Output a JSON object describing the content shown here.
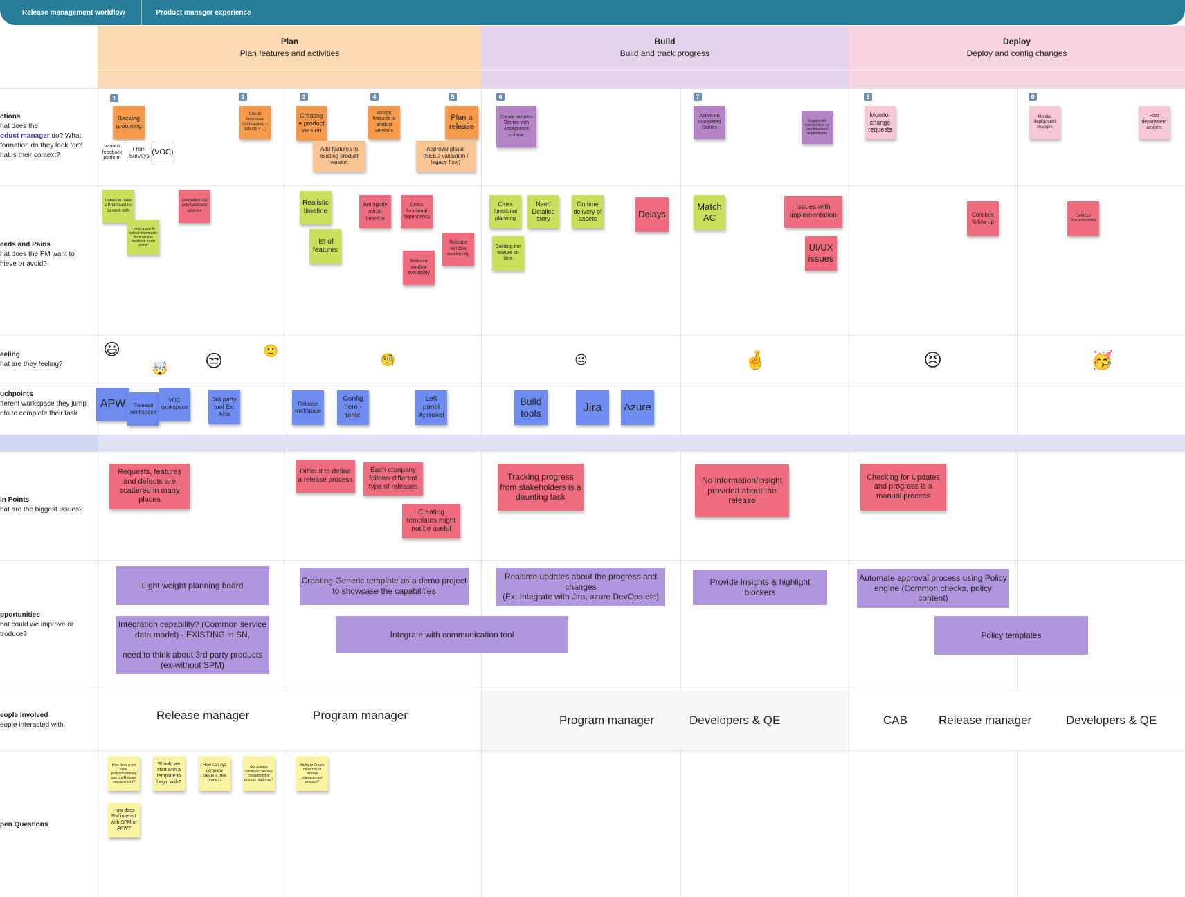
{
  "tabs": [
    "Release management workflow",
    "Product manager experience"
  ],
  "phases": [
    {
      "title": "Plan",
      "subtitle": "Plan features and activities",
      "color": "#fdd9b4"
    },
    {
      "title": "Build",
      "subtitle": "Build and track progress",
      "color": "#e4d4ec"
    },
    {
      "title": "Deploy",
      "subtitle": "Deploy and config changes",
      "color": "#f8d3e1"
    }
  ],
  "rows": {
    "actions": {
      "title": "ctions",
      "lines": [
        "hat does the",
        "oduct manager",
        " do? What",
        "formation do they look for?",
        "hat is their context?"
      ]
    },
    "needs": {
      "title": "eeds and Pains",
      "lines": [
        "hat does the PM want to",
        "hieve or avoid?"
      ]
    },
    "feeling": {
      "title": "eeling",
      "lines": [
        "hat are they feeling?"
      ]
    },
    "touchpoints": {
      "title": "uchpoints",
      "lines": [
        "fferent workspace they jump",
        "nto to complete their task"
      ]
    },
    "painpoints": {
      "title": "in Points",
      "lines": [
        "hat are the biggest issues?"
      ]
    },
    "opportunities": {
      "title": "pportunities",
      "lines": [
        "hat could we improve or",
        "troduce?"
      ]
    },
    "people": {
      "title": "eople involved",
      "lines": [
        "eople interacted with."
      ]
    },
    "questions": {
      "title": "pen Questions",
      "lines": []
    }
  },
  "step_numbers": [
    "1",
    "2",
    "3",
    "4",
    "5",
    "6",
    "7",
    "8",
    "9"
  ],
  "actions": [
    "Backlog grooming",
    "Various feedback platform",
    "From Surveys",
    "(VOC)",
    "Create Prioritised list(features + defects + ...)",
    "Creating a product version",
    "Add features to existing product version",
    "Assign features to product versions",
    "Plan a release",
    "Approval phase (NEED validation / legacy flow)",
    "Create detailed Stories with Acceptance criteria",
    "Action on completed Stories",
    "Engage with stakeholders for non functional requirements",
    "Monitor change requests",
    "Monitor deployment changes",
    "Post deployment actions"
  ],
  "needs": [
    "I need to have a Prioritised list to work with",
    "I need a way to collect information from various feedback touch points",
    "Overwhelmed with feedback sources",
    "Realistic timeline",
    "list of features",
    "Ambiguity about timeline",
    "Cross functional dependency",
    "Release window availability",
    "Release window availability",
    "Cross functional planning",
    "Need Detailed story",
    "On time delivery of assets",
    "Building the feature on time",
    "Delays",
    "Match AC",
    "Issues with implementation",
    "UI/UX issues",
    "Constant follow up",
    "Defects/ Vulnerabilities"
  ],
  "feelings": [
    "grinning",
    "exploding-head",
    "unamused",
    "slight-smile",
    "monocle",
    "neutral",
    "crossed-fingers",
    "persevering",
    "partying"
  ],
  "touchpoints": [
    "APW",
    "Release workspace",
    "VOC workspace",
    "3rd party tool Ex: Aha",
    "Release workspace",
    "Config Item - table",
    "Left panel Aprroval",
    "Build tools",
    "Jira",
    "Azure"
  ],
  "painpoints": [
    "Requests, features and defects are scattered in many places",
    "Difficult to define a release process",
    "Each company follows different type of releases",
    "Creating templates might not be useful",
    "Tracking progress from  stakeholders is a daunting task",
    "No information/insight provided about the release",
    "Checking for Updates and progress is a manual process"
  ],
  "opportunities": [
    "Light weight planning board",
    "Integration capability? (Common service data model) - EXISTING in SN,\n\nneed to think about 3rd party products (ex-without SPM)",
    "Creating Generic template as a demo project to showcase the capabilities",
    "Integrate with communication tool",
    "Realtime updates about the progress and changes\n(Ex: Integrate with Jira, azure DevOps etc)",
    "Provide Insights & highlight blockers",
    "Automate approval process using Policy engine (Common checks, policy content)",
    "Policy templates"
  ],
  "people": [
    "Release manager",
    "Program manager",
    "Program manager",
    "Developers & QE",
    "CAB",
    "Release manager",
    "Developers & QE"
  ],
  "questions": [
    "How does a net new project/company use our Release management?",
    "Should we start with a template to begin with?",
    "How can xyz company create a new process",
    "Are release windows/calendar created first or product road map?",
    "Ability to Create hierarchy of release management process?",
    "How does RM interact with SPM or APW?"
  ],
  "colors": {
    "topbar": "#277d98",
    "orange": "#f49a4a",
    "purple": "#b383c6",
    "red": "#ef6b7e",
    "green": "#c8e05c",
    "blue": "#6f8cf0",
    "lavender": "#b097dd",
    "yellow": "#fbf4a0"
  }
}
